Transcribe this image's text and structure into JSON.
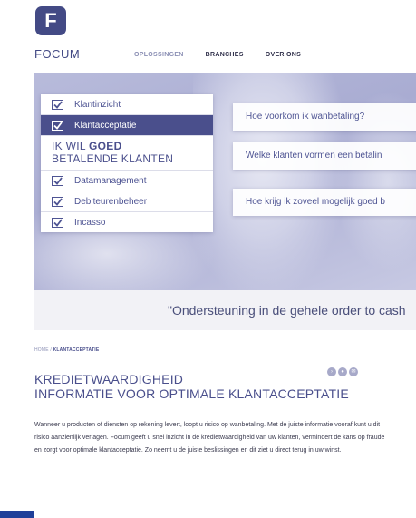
{
  "brand": {
    "logo_letter": "F",
    "name": "FOCUM",
    "color": "#434a85"
  },
  "nav": {
    "items": [
      "OPLOSSINGEN",
      "BRANCHES",
      "OVER ONS"
    ]
  },
  "hero_menu": {
    "items_top": [
      "Klantinzicht",
      "Klantacceptatie"
    ],
    "heading_line1_prefix": "IK WIL ",
    "heading_line1_bold": "GOED",
    "heading_line2": "BETALENDE KLANTEN",
    "items_bottom": [
      "Datamanagement",
      "Debiteurenbeheer",
      "Incasso"
    ]
  },
  "questions": [
    "Hoe voorkom ik wanbetaling?",
    "Welke klanten vormen een betalin",
    "Hoe krijg ik zoveel mogelijk goed b"
  ],
  "tagline": "\"Ondersteuning in de gehele order to cash",
  "breadcrumb": {
    "home": "HOME / ",
    "current": "KLANTACCEPTATIE"
  },
  "page": {
    "title_line1": "KREDIETWAARDIGHEID",
    "title_line2": "INFORMATIE VOOR OPTIMALE KLANTACCEPTATIE",
    "body": "Wanneer u producten of diensten op rekening levert, loopt u risico op wanbetaling. Met de juiste informatie vooraf kunt u dit risico aanzienlijk verlagen. Focum geeft u snel inzicht in de kredietwaardigheid van uw klanten, vermindert de kans op fraude en zorgt voor optimale klantacceptatie. Zo neemt u de juiste beslissingen en dit ziet u direct terug in uw winst."
  },
  "colors": {
    "accent": "#4a4f8c",
    "hero_bg": "#b8bbdb",
    "edge_bar": "#1f3f99"
  }
}
